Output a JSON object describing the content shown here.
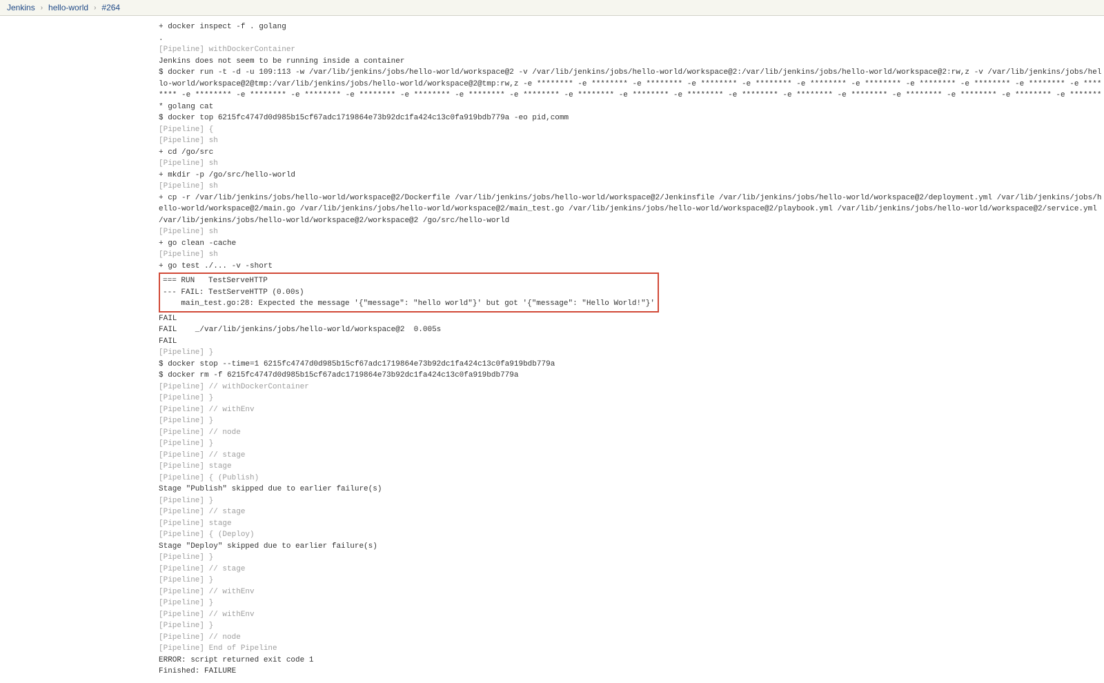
{
  "breadcrumb": {
    "root": "Jenkins",
    "project": "hello-world",
    "build": "#264"
  },
  "console": {
    "lines": [
      {
        "marker": false,
        "text": "+ docker inspect -f . golang"
      },
      {
        "marker": false,
        "text": "."
      },
      {
        "marker": true,
        "text": "[Pipeline] withDockerContainer"
      },
      {
        "marker": false,
        "text": "Jenkins does not seem to be running inside a container"
      },
      {
        "marker": false,
        "text": "$ docker run -t -d -u 109:113 -w /var/lib/jenkins/jobs/hello-world/workspace@2 -v /var/lib/jenkins/jobs/hello-world/workspace@2:/var/lib/jenkins/jobs/hello-world/workspace@2:rw,z -v /var/lib/jenkins/jobs/hello-world/workspace@2@tmp:/var/lib/jenkins/jobs/hello-world/workspace@2@tmp:rw,z -e ******** -e ******** -e ******** -e ******** -e ******** -e ******** -e ******** -e ******** -e ******** -e ******** -e ******** -e ******** -e ******** -e ******** -e ******** -e ******** -e ******** -e ******** -e ******** -e ******** -e ******** -e ******** -e ******** -e ******** -e ******** -e ******** -e ******** -e ******** golang cat"
      },
      {
        "marker": false,
        "text": "$ docker top 6215fc4747d0d985b15cf67adc1719864e73b92dc1fa424c13c0fa919bdb779a -eo pid,comm"
      },
      {
        "marker": true,
        "text": "[Pipeline] {"
      },
      {
        "marker": true,
        "text": "[Pipeline] sh"
      },
      {
        "marker": false,
        "text": "+ cd /go/src"
      },
      {
        "marker": true,
        "text": "[Pipeline] sh"
      },
      {
        "marker": false,
        "text": "+ mkdir -p /go/src/hello-world"
      },
      {
        "marker": true,
        "text": "[Pipeline] sh"
      },
      {
        "marker": false,
        "text": "+ cp -r /var/lib/jenkins/jobs/hello-world/workspace@2/Dockerfile /var/lib/jenkins/jobs/hello-world/workspace@2/Jenkinsfile /var/lib/jenkins/jobs/hello-world/workspace@2/deployment.yml /var/lib/jenkins/jobs/hello-world/workspace@2/main.go /var/lib/jenkins/jobs/hello-world/workspace@2/main_test.go /var/lib/jenkins/jobs/hello-world/workspace@2/playbook.yml /var/lib/jenkins/jobs/hello-world/workspace@2/service.yml /var/lib/jenkins/jobs/hello-world/workspace@2/workspace@2 /go/src/hello-world"
      },
      {
        "marker": true,
        "text": "[Pipeline] sh"
      },
      {
        "marker": false,
        "text": "+ go clean -cache"
      },
      {
        "marker": true,
        "text": "[Pipeline] sh"
      },
      {
        "marker": false,
        "text": "+ go test ./... -v -short"
      }
    ],
    "highlighted": [
      "=== RUN   TestServeHTTP",
      "--- FAIL: TestServeHTTP (0.00s)",
      "    main_test.go:28: Expected the message '{\"message\": \"hello world\"}' but got '{\"message\": \"Hello World!\"}'"
    ],
    "lines_after": [
      {
        "marker": false,
        "text": "FAIL"
      },
      {
        "marker": false,
        "text": "FAIL    _/var/lib/jenkins/jobs/hello-world/workspace@2  0.005s"
      },
      {
        "marker": false,
        "text": "FAIL"
      },
      {
        "marker": true,
        "text": "[Pipeline] }"
      },
      {
        "marker": false,
        "text": "$ docker stop --time=1 6215fc4747d0d985b15cf67adc1719864e73b92dc1fa424c13c0fa919bdb779a"
      },
      {
        "marker": false,
        "text": "$ docker rm -f 6215fc4747d0d985b15cf67adc1719864e73b92dc1fa424c13c0fa919bdb779a"
      },
      {
        "marker": true,
        "text": "[Pipeline] // withDockerContainer"
      },
      {
        "marker": true,
        "text": "[Pipeline] }"
      },
      {
        "marker": true,
        "text": "[Pipeline] // withEnv"
      },
      {
        "marker": true,
        "text": "[Pipeline] }"
      },
      {
        "marker": true,
        "text": "[Pipeline] // node"
      },
      {
        "marker": true,
        "text": "[Pipeline] }"
      },
      {
        "marker": true,
        "text": "[Pipeline] // stage"
      },
      {
        "marker": true,
        "text": "[Pipeline] stage"
      },
      {
        "marker": true,
        "text": "[Pipeline] { (Publish)"
      },
      {
        "marker": false,
        "text": "Stage \"Publish\" skipped due to earlier failure(s)"
      },
      {
        "marker": true,
        "text": "[Pipeline] }"
      },
      {
        "marker": true,
        "text": "[Pipeline] // stage"
      },
      {
        "marker": true,
        "text": "[Pipeline] stage"
      },
      {
        "marker": true,
        "text": "[Pipeline] { (Deploy)"
      },
      {
        "marker": false,
        "text": "Stage \"Deploy\" skipped due to earlier failure(s)"
      },
      {
        "marker": true,
        "text": "[Pipeline] }"
      },
      {
        "marker": true,
        "text": "[Pipeline] // stage"
      },
      {
        "marker": true,
        "text": "[Pipeline] }"
      },
      {
        "marker": true,
        "text": "[Pipeline] // withEnv"
      },
      {
        "marker": true,
        "text": "[Pipeline] }"
      },
      {
        "marker": true,
        "text": "[Pipeline] // withEnv"
      },
      {
        "marker": true,
        "text": "[Pipeline] }"
      },
      {
        "marker": true,
        "text": "[Pipeline] // node"
      },
      {
        "marker": true,
        "text": "[Pipeline] End of Pipeline"
      },
      {
        "marker": false,
        "text": "ERROR: script returned exit code 1"
      },
      {
        "marker": false,
        "text": "Finished: FAILURE"
      }
    ]
  }
}
